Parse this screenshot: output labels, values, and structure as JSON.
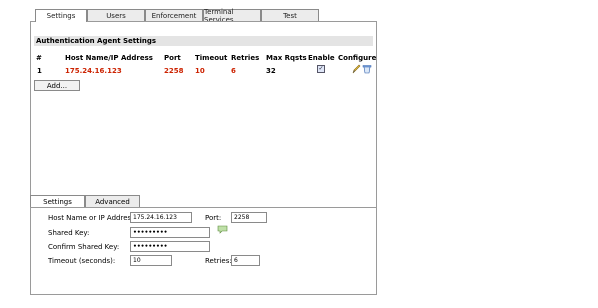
{
  "tabs": [
    {
      "label": "Settings",
      "active": true
    },
    {
      "label": "Users",
      "active": false
    },
    {
      "label": "Enforcement",
      "active": false
    },
    {
      "label": "Terminal Services",
      "active": false
    },
    {
      "label": "Test",
      "active": false
    }
  ],
  "section_title": "Authentication Agent Settings",
  "table": {
    "headers": [
      "#",
      "Host Name/IP Address",
      "Port",
      "Timeout",
      "Retries",
      "Max Rqsts",
      "Enable",
      "Configure"
    ],
    "rows": [
      {
        "num": "1",
        "host": "175.24.16.123",
        "port": "2258",
        "timeout": "10",
        "retries": "6",
        "max_rqsts": "32",
        "enabled": true
      }
    ]
  },
  "add_button": "Add...",
  "subtabs": [
    {
      "label": "Settings",
      "active": true
    },
    {
      "label": "Advanced",
      "active": false
    }
  ],
  "form": {
    "host_label": "Host Name or IP Address:",
    "host_value": "175.24.16.123",
    "port_label": "Port:",
    "port_value": "2258",
    "shared_key_label": "Shared Key:",
    "shared_key_value": "•••••••••",
    "confirm_key_label": "Confirm Shared Key:",
    "confirm_key_value": "•••••••••",
    "timeout_label": "Timeout (seconds):",
    "timeout_value": "10",
    "retries_label": "Retries:",
    "retries_value": "6"
  },
  "colors": {
    "accent_red": "#cc2200"
  },
  "icons": {
    "edit": "pencil-icon",
    "delete": "trash-icon",
    "key_generate": "speech-bubble-icon"
  }
}
